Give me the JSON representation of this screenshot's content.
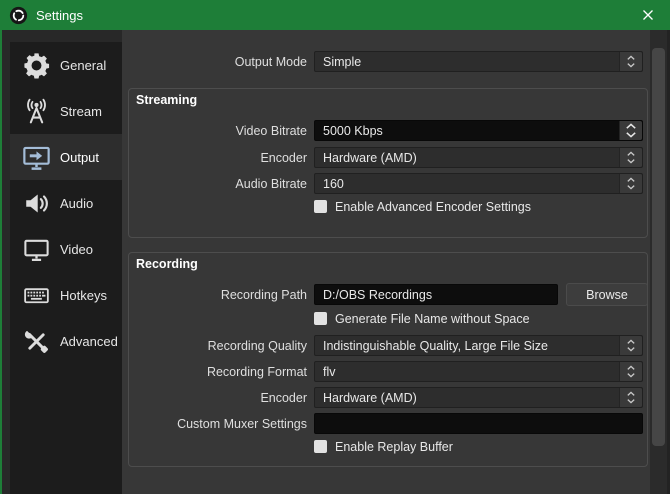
{
  "window": {
    "title": "Settings"
  },
  "titlebar": {
    "close_icon": "close-icon"
  },
  "sidebar": {
    "items": [
      {
        "label": "General",
        "icon": "gear-icon",
        "selected": false
      },
      {
        "label": "Stream",
        "icon": "broadcast-icon",
        "selected": false
      },
      {
        "label": "Output",
        "icon": "monitor-arrow-icon",
        "selected": true
      },
      {
        "label": "Audio",
        "icon": "speaker-icon",
        "selected": false
      },
      {
        "label": "Video",
        "icon": "monitor-icon",
        "selected": false
      },
      {
        "label": "Hotkeys",
        "icon": "keyboard-icon",
        "selected": false
      },
      {
        "label": "Advanced",
        "icon": "tools-icon",
        "selected": false
      }
    ]
  },
  "main": {
    "output_mode": {
      "label": "Output Mode",
      "value": "Simple"
    },
    "streaming": {
      "title": "Streaming",
      "video_bitrate": {
        "label": "Video Bitrate",
        "value": "5000 Kbps"
      },
      "encoder": {
        "label": "Encoder",
        "value": "Hardware (AMD)"
      },
      "audio_bitrate": {
        "label": "Audio Bitrate",
        "value": "160"
      },
      "advanced_checkbox": {
        "label": "Enable Advanced Encoder Settings",
        "checked": false
      }
    },
    "recording": {
      "title": "Recording",
      "path": {
        "label": "Recording Path",
        "value": "D:/OBS Recordings",
        "browse": "Browse"
      },
      "filename_checkbox": {
        "label": "Generate File Name without Space",
        "checked": false
      },
      "quality": {
        "label": "Recording Quality",
        "value": "Indistinguishable Quality, Large File Size"
      },
      "format": {
        "label": "Recording Format",
        "value": "flv"
      },
      "encoder": {
        "label": "Encoder",
        "value": "Hardware (AMD)"
      },
      "muxer": {
        "label": "Custom Muxer Settings",
        "value": ""
      },
      "replay_checkbox": {
        "label": "Enable Replay Buffer",
        "checked": false
      }
    }
  },
  "colors": {
    "titlebar_green": "#1e7e38",
    "main_bg": "#373737",
    "sidebar_list_bg": "#1c1c1c",
    "selected_item_bg": "#2d2d2d",
    "combo_bg": "#2d2d2d",
    "dark_input_bg": "#0d0d0d",
    "selected_icon_blue": "#a4bdd8",
    "icon_gray": "#dcdcdc"
  }
}
